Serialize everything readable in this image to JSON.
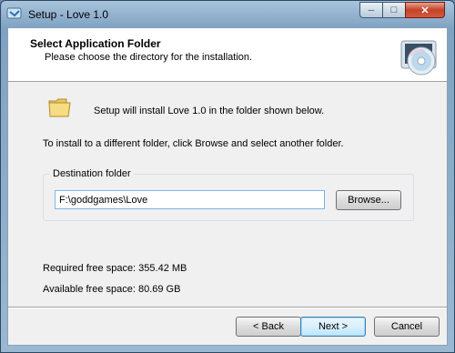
{
  "window": {
    "title": "Setup - Love 1.0",
    "minimize_glyph": "─",
    "maximize_glyph": "□",
    "close_glyph": "✕"
  },
  "header": {
    "title": "Select Application Folder",
    "subtitle": "Please choose the directory for the installation."
  },
  "body": {
    "install_message": "Setup will install Love 1.0 in the folder shown below.",
    "browse_hint": "To install to a different folder, click Browse and select another folder.",
    "destination_label": "Destination folder",
    "destination_path": "F:\\goddgames\\Love",
    "browse_label": "Browse...",
    "required_space": "Required free space: 355.42 MB",
    "available_space": "Available free space: 80.69 GB"
  },
  "footer": {
    "back_label": "< Back",
    "next_label": "Next >",
    "cancel_label": "Cancel"
  },
  "icons": {
    "app": "setup-app-icon",
    "header": "cd-disc-icon",
    "folder": "folder-icon"
  }
}
